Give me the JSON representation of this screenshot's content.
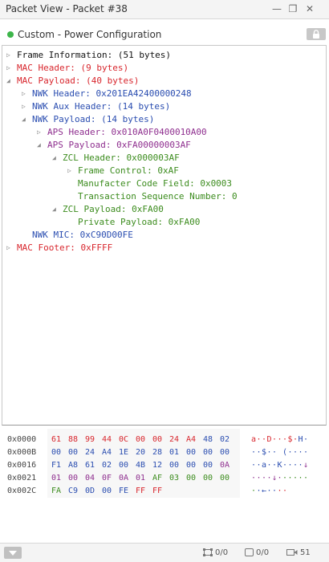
{
  "window": {
    "title": "Packet View - Packet #38",
    "minimize_glyph": "—",
    "restore_glyph": "❐",
    "close_glyph": "✕"
  },
  "subheader": {
    "status_color": "#3db54a",
    "label": "Custom - Power Configuration"
  },
  "tree": [
    {
      "text": "Frame Information: (51 bytes)",
      "color": "black",
      "toggle": "collapsed"
    },
    {
      "text": "MAC Header: (9 bytes)",
      "color": "red",
      "toggle": "collapsed"
    },
    {
      "text": "MAC Payload: (40 bytes)",
      "color": "red",
      "toggle": "expanded"
    },
    {
      "text": "NWK Header: 0x201EA42400000248",
      "color": "blue",
      "toggle": "collapsed"
    },
    {
      "text": "NWK Aux Header: (14 bytes)",
      "color": "blue",
      "toggle": "collapsed"
    },
    {
      "text": "NWK Payload: (14 bytes)",
      "color": "blue",
      "toggle": "expanded"
    },
    {
      "text": "APS Header: 0x010A0F0400010A00",
      "color": "purple",
      "toggle": "collapsed"
    },
    {
      "text": "APS Payload: 0xFA00000003AF",
      "color": "purple",
      "toggle": "expanded"
    },
    {
      "text": "ZCL Header: 0x000003AF",
      "color": "green",
      "toggle": "expanded"
    },
    {
      "text": "Frame Control: 0xAF",
      "color": "green",
      "toggle": "collapsed"
    },
    {
      "text": "Manufacter Code Field: 0x0003",
      "color": "green",
      "toggle": "none"
    },
    {
      "text": "Transaction Sequence Number: 0",
      "color": "green",
      "toggle": "none"
    },
    {
      "text": "ZCL Payload: 0xFA00",
      "color": "green",
      "toggle": "expanded"
    },
    {
      "text": "Private Payload: 0xFA00",
      "color": "green",
      "toggle": "none"
    },
    {
      "text": "NWK MIC: 0xC90D00FE",
      "color": "blue",
      "toggle": "none"
    },
    {
      "text": "MAC Footer: 0xFFFF",
      "color": "red",
      "toggle": "collapsed"
    }
  ],
  "hex_dump": [
    {
      "offset": "0x0000",
      "bytes": [
        {
          "v": "61",
          "c": "red"
        },
        {
          "v": "88",
          "c": "red"
        },
        {
          "v": "99",
          "c": "red"
        },
        {
          "v": "44",
          "c": "red"
        },
        {
          "v": "0C",
          "c": "red"
        },
        {
          "v": "00",
          "c": "red"
        },
        {
          "v": "00",
          "c": "red"
        },
        {
          "v": "24",
          "c": "red"
        },
        {
          "v": "A4",
          "c": "red"
        },
        {
          "v": "48",
          "c": "blue"
        },
        {
          "v": "02",
          "c": "blue"
        }
      ],
      "ascii": [
        {
          "v": "a",
          "c": "red"
        },
        {
          "v": "·",
          "c": "red"
        },
        {
          "v": "·",
          "c": "red"
        },
        {
          "v": "D",
          "c": "red"
        },
        {
          "v": "·",
          "c": "red"
        },
        {
          "v": "·",
          "c": "red"
        },
        {
          "v": "·",
          "c": "red"
        },
        {
          "v": "$",
          "c": "red"
        },
        {
          "v": "·",
          "c": "red"
        },
        {
          "v": "H",
          "c": "blue"
        },
        {
          "v": "·",
          "c": "blue"
        }
      ]
    },
    {
      "offset": "0x000B",
      "bytes": [
        {
          "v": "00",
          "c": "blue"
        },
        {
          "v": "00",
          "c": "blue"
        },
        {
          "v": "24",
          "c": "blue"
        },
        {
          "v": "A4",
          "c": "blue"
        },
        {
          "v": "1E",
          "c": "blue"
        },
        {
          "v": "20",
          "c": "blue"
        },
        {
          "v": "28",
          "c": "blue"
        },
        {
          "v": "01",
          "c": "blue"
        },
        {
          "v": "00",
          "c": "blue"
        },
        {
          "v": "00",
          "c": "blue"
        },
        {
          "v": "00",
          "c": "blue"
        }
      ],
      "ascii": [
        {
          "v": "·",
          "c": "blue"
        },
        {
          "v": "·",
          "c": "blue"
        },
        {
          "v": "$",
          "c": "blue"
        },
        {
          "v": "·",
          "c": "blue"
        },
        {
          "v": "·",
          "c": "blue"
        },
        {
          "v": " ",
          "c": "blue"
        },
        {
          "v": "(",
          "c": "blue"
        },
        {
          "v": "·",
          "c": "blue"
        },
        {
          "v": "·",
          "c": "blue"
        },
        {
          "v": "·",
          "c": "blue"
        },
        {
          "v": "·",
          "c": "blue"
        }
      ]
    },
    {
      "offset": "0x0016",
      "bytes": [
        {
          "v": "F1",
          "c": "blue"
        },
        {
          "v": "A8",
          "c": "blue"
        },
        {
          "v": "61",
          "c": "blue"
        },
        {
          "v": "02",
          "c": "blue"
        },
        {
          "v": "00",
          "c": "blue"
        },
        {
          "v": "4B",
          "c": "blue"
        },
        {
          "v": "12",
          "c": "blue"
        },
        {
          "v": "00",
          "c": "blue"
        },
        {
          "v": "00",
          "c": "blue"
        },
        {
          "v": "00",
          "c": "blue"
        },
        {
          "v": "0A",
          "c": "purple"
        }
      ],
      "ascii": [
        {
          "v": "·",
          "c": "blue"
        },
        {
          "v": "·",
          "c": "blue"
        },
        {
          "v": "a",
          "c": "blue"
        },
        {
          "v": "·",
          "c": "blue"
        },
        {
          "v": "·",
          "c": "blue"
        },
        {
          "v": "K",
          "c": "blue"
        },
        {
          "v": "·",
          "c": "blue"
        },
        {
          "v": "·",
          "c": "blue"
        },
        {
          "v": "·",
          "c": "blue"
        },
        {
          "v": "·",
          "c": "blue"
        },
        {
          "v": "↓",
          "c": "purple"
        }
      ]
    },
    {
      "offset": "0x0021",
      "bytes": [
        {
          "v": "01",
          "c": "purple"
        },
        {
          "v": "00",
          "c": "purple"
        },
        {
          "v": "04",
          "c": "purple"
        },
        {
          "v": "0F",
          "c": "purple"
        },
        {
          "v": "0A",
          "c": "purple"
        },
        {
          "v": "01",
          "c": "purple"
        },
        {
          "v": "AF",
          "c": "green"
        },
        {
          "v": "03",
          "c": "green"
        },
        {
          "v": "00",
          "c": "green"
        },
        {
          "v": "00",
          "c": "green"
        },
        {
          "v": "00",
          "c": "green"
        }
      ],
      "ascii": [
        {
          "v": "·",
          "c": "purple"
        },
        {
          "v": "·",
          "c": "purple"
        },
        {
          "v": "·",
          "c": "purple"
        },
        {
          "v": "·",
          "c": "purple"
        },
        {
          "v": "↓",
          "c": "purple"
        },
        {
          "v": "·",
          "c": "purple"
        },
        {
          "v": "·",
          "c": "green"
        },
        {
          "v": "·",
          "c": "green"
        },
        {
          "v": "·",
          "c": "green"
        },
        {
          "v": "·",
          "c": "green"
        },
        {
          "v": "·",
          "c": "green"
        }
      ]
    },
    {
      "offset": "0x002C",
      "bytes": [
        {
          "v": "FA",
          "c": "green"
        },
        {
          "v": "C9",
          "c": "blue"
        },
        {
          "v": "0D",
          "c": "blue"
        },
        {
          "v": "00",
          "c": "blue"
        },
        {
          "v": "FE",
          "c": "blue"
        },
        {
          "v": "FF",
          "c": "red"
        },
        {
          "v": "FF",
          "c": "red"
        }
      ],
      "ascii": [
        {
          "v": "·",
          "c": "green"
        },
        {
          "v": "·",
          "c": "blue"
        },
        {
          "v": "←",
          "c": "blue"
        },
        {
          "v": "·",
          "c": "blue"
        },
        {
          "v": "·",
          "c": "blue"
        },
        {
          "v": "·",
          "c": "red"
        },
        {
          "v": "·",
          "c": "red"
        }
      ]
    }
  ],
  "colors": {
    "black": "#111111",
    "red": "#d8262d",
    "blue": "#2a4db0",
    "purple": "#8f2f8f",
    "green": "#3c8c1e"
  },
  "statusbar": {
    "selection_count": "0/0",
    "bookmark_count": "0/0",
    "packet_count": "51"
  }
}
